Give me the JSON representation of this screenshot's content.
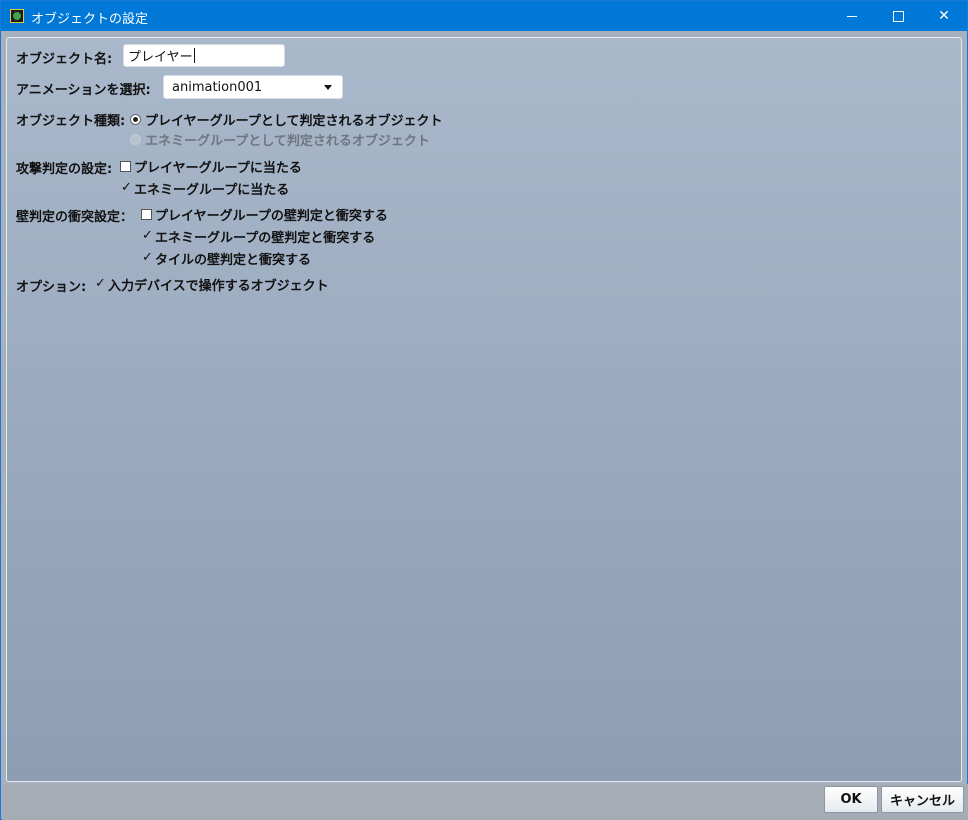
{
  "window": {
    "title": "オブジェクトの設定",
    "close_glyph": "✕"
  },
  "form": {
    "object_name": {
      "label": "オブジェクト名:",
      "value": "プレイヤー"
    },
    "animation": {
      "label": "アニメーションを選択:",
      "selected": "animation001"
    },
    "object_type": {
      "label": "オブジェクト種類:",
      "options": [
        {
          "label": "プレイヤーグループとして判定されるオブジェクト",
          "selected": true,
          "enabled": true
        },
        {
          "label": "エネミーグループとして判定されるオブジェクト",
          "selected": false,
          "enabled": false
        }
      ]
    },
    "attack_hit": {
      "label": "攻撃判定の設定:",
      "options": [
        {
          "label": "プレイヤーグループに当たる",
          "checked": false
        },
        {
          "label": "エネミーグループに当たる",
          "checked": true
        }
      ]
    },
    "wall_collision": {
      "label": "壁判定の衝突設定：",
      "options": [
        {
          "label": "プレイヤーグループの壁判定と衝突する",
          "checked": false
        },
        {
          "label": "エネミーグループの壁判定と衝突する",
          "checked": true
        },
        {
          "label": "タイルの壁判定と衝突する",
          "checked": true
        }
      ]
    },
    "options": {
      "label": "オプション:",
      "items": [
        {
          "label": "入力デバイスで操作するオブジェクト",
          "checked": true
        }
      ]
    }
  },
  "buttons": {
    "ok": "OK",
    "cancel": "キャンセル"
  }
}
